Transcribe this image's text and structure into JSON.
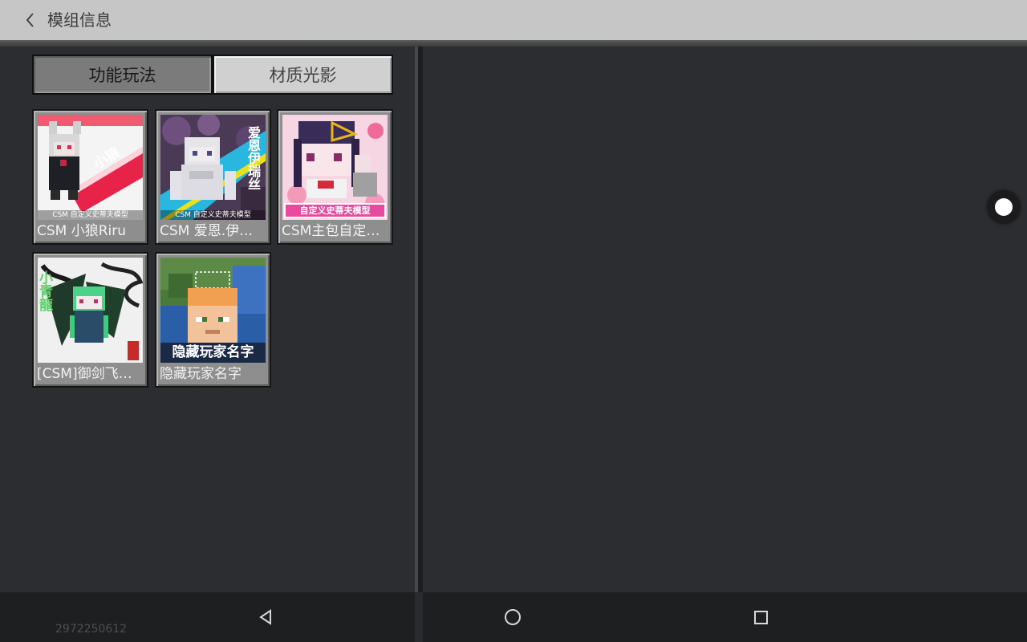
{
  "header": {
    "title": "模组信息",
    "back_icon": "chevron-left-icon"
  },
  "tabs": [
    {
      "label": "功能玩法",
      "active": true
    },
    {
      "label": "材质光影",
      "active": false
    }
  ],
  "mods": [
    {
      "name": "CSM 小狼Riru",
      "thumb_banner": "小狼",
      "thumb_caption": "CSM 自定义史蒂夫模型"
    },
    {
      "name": "CSM 爱恩.伊瑞丝",
      "thumb_banner": "爱恩伊瑞丝",
      "thumb_caption": "CSM 自定义史蒂夫模型"
    },
    {
      "name": "CSM主包自定义史蒂夫模型",
      "thumb_banner": "自定义史蒂夫模型",
      "thumb_caption": ""
    },
    {
      "name": "[CSM]御剑飞行小青龙",
      "thumb_banner": "小青龍",
      "thumb_caption": ""
    },
    {
      "name": "隐藏玩家名字",
      "thumb_banner": "隐藏玩家名字",
      "thumb_caption": ""
    }
  ],
  "floating_button": {
    "icon": "assistive-touch-icon"
  },
  "navbar": {
    "device_id": "2972250612",
    "back_icon": "triangle-back-icon",
    "home_icon": "circle-home-icon",
    "recents_icon": "square-recents-icon"
  },
  "colors": {
    "header_bg": "#c6c6c6",
    "panel_bg": "#2c2d30",
    "card_bg": "#8e8e8e",
    "tab_active_bg": "#7b7b7b",
    "tab_inactive_bg": "#d0d0d0",
    "navbar_bg": "#1e1f21"
  }
}
